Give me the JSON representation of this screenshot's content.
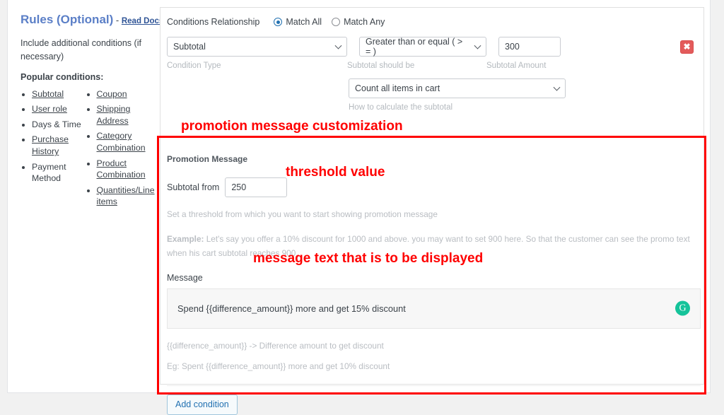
{
  "sidebar": {
    "title": "Rules (Optional)",
    "dash": " - ",
    "read_docs": "Read Docs",
    "subtitle": "Include additional conditions (if necessary)",
    "popular_heading": "Popular conditions:",
    "column_left": [
      {
        "label": "Subtotal",
        "link": true
      },
      {
        "label": "User role",
        "link": true
      },
      {
        "label": "Days & Time",
        "link": false
      },
      {
        "label": "Purchase History",
        "link": true
      },
      {
        "label": "Payment Method",
        "link": false
      }
    ],
    "column_right": [
      {
        "label": "Coupon",
        "link": true
      },
      {
        "label": "Shipping Address",
        "link": true
      },
      {
        "label": "Category Combination",
        "link": true
      },
      {
        "label": "Product Combination",
        "link": true
      },
      {
        "label": "Quantities/Line items",
        "link": true
      }
    ]
  },
  "panel": {
    "relationship_label": "Conditions Relationship",
    "match_all": "Match All",
    "match_any": "Match Any",
    "match_selected": "Match All",
    "condition_type_value": "Subtotal",
    "condition_type_hint": "Condition Type",
    "operator_value": "Greater than or equal ( > = )",
    "operator_hint": "Subtotal should be",
    "amount_value": "300",
    "amount_hint": "Subtotal Amount",
    "delete_icon": "✖",
    "calc_value": "Count all items in cart",
    "calc_hint": "How to calculate the subtotal"
  },
  "promotion": {
    "section_title": "Promotion Message",
    "subtotal_from_label": "Subtotal from",
    "subtotal_from_value": "250",
    "threshold_desc": "Set a threshold from which you want to start showing promotion message",
    "example_prefix": "Example:",
    "example_text": " Let's say you offer a 10% discount for 1000 and above. you may want to set 900 here. So that the customer can see the promo text when his cart subtotal reaches 900",
    "message_label": "Message",
    "message_value": "Spend {{difference_amount}} more and get 15% discount",
    "grammarly_icon": "G",
    "var_hint_1": "{{difference_amount}} -> Difference amount to get discount",
    "var_hint_2": "Eg: Spent {{difference_amount}} more and get 10% discount",
    "add_condition": "Add condition"
  },
  "annotations": {
    "promo_customization": "promotion message customization",
    "threshold_value": "threshold value",
    "message_text": "message text that is to be displayed",
    "color": "#ff0000"
  }
}
